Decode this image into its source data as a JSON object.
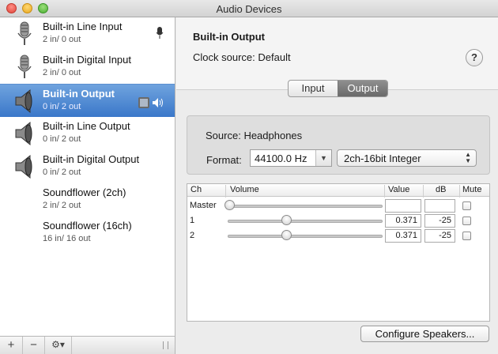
{
  "window": {
    "title": "Audio Devices"
  },
  "devices": [
    {
      "name": "Built-in Line Input",
      "io": "2 in/ 0 out",
      "icon": "microphone-icon",
      "selected": false,
      "badge": "microphone"
    },
    {
      "name": "Built-in Digital Input",
      "io": "2 in/ 0 out",
      "icon": "microphone-icon",
      "selected": false
    },
    {
      "name": "Built-in Output",
      "io": "0 in/ 2 out",
      "icon": "speaker-icon",
      "selected": true,
      "badge": "finder-speaker"
    },
    {
      "name": "Built-in Line Output",
      "io": "0 in/ 2 out",
      "icon": "speaker-icon",
      "selected": false
    },
    {
      "name": "Built-in Digital Output",
      "io": "0 in/ 2 out",
      "icon": "speaker-icon",
      "selected": false
    },
    {
      "name": "Soundflower (2ch)",
      "io": "2 in/ 2 out",
      "icon": "",
      "selected": false
    },
    {
      "name": "Soundflower (16ch)",
      "io": "16 in/ 16 out",
      "icon": "",
      "selected": false
    }
  ],
  "footer": {
    "add": "+",
    "remove": "−",
    "gear": "⚙▾"
  },
  "detail": {
    "title": "Built-in Output",
    "clock_label": "Clock source:",
    "clock_value": "Default",
    "help": "?",
    "tabs": [
      "Input",
      "Output"
    ],
    "active_tab": "Output",
    "source_label": "Source:",
    "source_value": "Headphones",
    "format_label": "Format:",
    "sample_rate": "44100.0 Hz",
    "bit_format": "2ch-16bit Integer",
    "configure": "Configure Speakers..."
  },
  "volume_table": {
    "headers": {
      "ch": "Ch",
      "volume": "Volume",
      "value": "Value",
      "db": "dB",
      "mute": "Mute"
    },
    "rows": [
      {
        "ch": "Master",
        "value": "",
        "db": "",
        "level": 0.0,
        "muted": false
      },
      {
        "ch": "1",
        "value": "0.371",
        "db": "-25",
        "level": 0.371,
        "muted": false
      },
      {
        "ch": "2",
        "value": "0.371",
        "db": "-25",
        "level": 0.371,
        "muted": false
      }
    ]
  },
  "colors": {
    "selection": "#3a77c9",
    "active_tab": "#6a6a6a"
  }
}
